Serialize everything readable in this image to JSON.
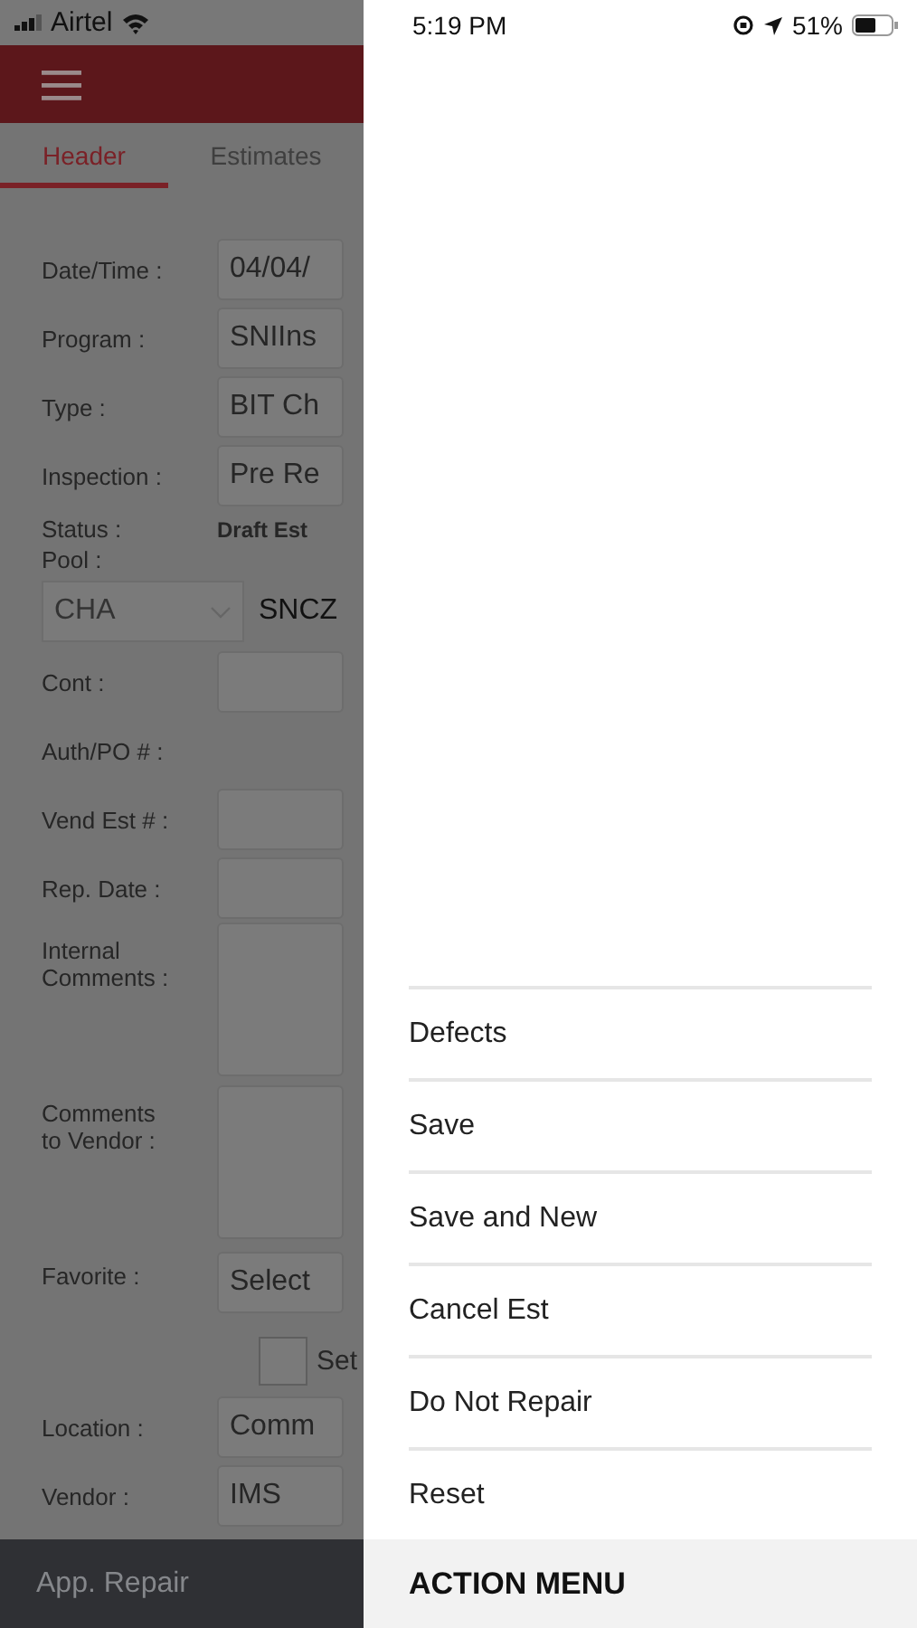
{
  "status_bar": {
    "carrier": "Airtel",
    "time": "5:19 PM",
    "battery": "51%"
  },
  "tabs": [
    {
      "label": "Header",
      "selected": true
    },
    {
      "label": "Estimates",
      "selected": false
    }
  ],
  "form": [
    {
      "kind": "field",
      "label": "Date/Time :",
      "value": "04/04/"
    },
    {
      "kind": "field",
      "label": "Program :",
      "value": "SNIIns"
    },
    {
      "kind": "field",
      "label": "Type :",
      "value": "BIT Ch"
    },
    {
      "kind": "field",
      "label": "Inspection :",
      "value": "Pre Re"
    },
    {
      "kind": "status",
      "label": "Status :",
      "value": "Draft Est"
    },
    {
      "kind": "pool",
      "label": "Pool :",
      "value": "CHA",
      "code": "SNCZ"
    },
    {
      "kind": "field",
      "label": "Cont :"
    },
    {
      "kind": "plain",
      "label": "Auth/PO # :"
    },
    {
      "kind": "field",
      "label": "Vend Est # :"
    },
    {
      "kind": "field",
      "label": "Rep. Date :"
    },
    {
      "kind": "textarea",
      "label": "Internal Comments :"
    },
    {
      "kind": "textarea",
      "label": "Comments to Vendor :"
    },
    {
      "kind": "favorite",
      "label": "Favorite :",
      "value": "Select"
    },
    {
      "kind": "checkbox",
      "label": "Set",
      "checked": false
    },
    {
      "kind": "field",
      "label": "Location :",
      "value": "Comm"
    },
    {
      "kind": "field",
      "label": "Vendor :",
      "value": "IMS"
    }
  ],
  "bottom_bar": {
    "label": "App. Repair"
  },
  "action_menu": {
    "items": [
      "Defects",
      "Save",
      "Save and New",
      "Cancel Est",
      "Do Not Repair",
      "Reset"
    ],
    "title": "ACTION MENU"
  }
}
